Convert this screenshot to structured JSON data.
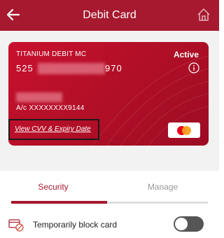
{
  "header": {
    "title": "Debit Card",
    "back_icon": "arrow-left-icon",
    "home_icon": "home-icon"
  },
  "card": {
    "product_name": "TITANIUM DEBIT MC",
    "status": "Active",
    "number_prefix": "525",
    "number_suffix": "970",
    "account_line": "A/c XXXXXXXX9144",
    "view_cvv_label": "View CVV & Expiry Date",
    "network_icon": "mastercard-logo-icon",
    "info_icon": "info-icon",
    "colors": {
      "card_red": "#c8102e",
      "highlight_border": "#1a1a1a"
    }
  },
  "tabs": {
    "security_label": "Security",
    "manage_label": "Manage",
    "active_color": "#a6192e"
  },
  "settings": {
    "block_label": "Temporarily block card",
    "block_icon": "card-block-icon"
  },
  "theme": {
    "brand": "#a6192e",
    "page_bg": "#f2f2f2"
  }
}
